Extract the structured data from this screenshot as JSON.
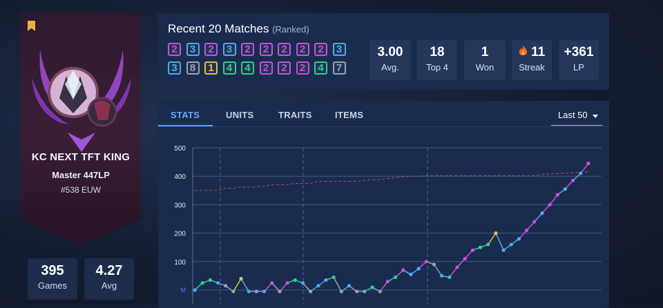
{
  "profile": {
    "summoner_name": "KC NEXT TFT KING",
    "rank": "Master 447LP",
    "ladder": "#538 EUW",
    "games_value": "395",
    "games_label": "Games",
    "avg_value": "4.27",
    "avg_label": "Avg"
  },
  "recent": {
    "title": "Recent 20 Matches",
    "subtitle": "(Ranked)",
    "placements": [
      2,
      3,
      2,
      3,
      2,
      2,
      2,
      2,
      2,
      3,
      3,
      8,
      1,
      4,
      4,
      2,
      2,
      2,
      4,
      7
    ],
    "placement_colors": {
      "1": "#e5c04a",
      "2": "#c850d8",
      "3": "#4fa8ec",
      "4": "#2fcf8e",
      "7": "#9aa2b2",
      "8": "#9aa2b2"
    },
    "stats": [
      {
        "value": "3.00",
        "label": "Avg."
      },
      {
        "value": "18",
        "label": "Top 4"
      },
      {
        "value": "1",
        "label": "Won"
      },
      {
        "value": "11",
        "label": "Streak"
      },
      {
        "value": "+361",
        "label": "LP"
      }
    ]
  },
  "tabs": [
    "STATS",
    "UNITS",
    "TRAITS",
    "ITEMS"
  ],
  "active_tab": "STATS",
  "range_select": "Last 50",
  "chart_data": {
    "type": "line",
    "y_ticks": [
      "500",
      "400",
      "300",
      "200",
      "100"
    ],
    "ylim": [
      0,
      500
    ],
    "baseline_label": "M",
    "series": [
      {
        "values": [
          0,
          25,
          35,
          25,
          15,
          -5,
          40,
          -5,
          -5,
          -5,
          25,
          -5,
          25,
          35,
          25,
          -5,
          15,
          35,
          45,
          -5,
          15,
          -5,
          -5,
          10,
          -5,
          30,
          45,
          70,
          55,
          75,
          100,
          90,
          50,
          45,
          80,
          110,
          140,
          150,
          160,
          200,
          140,
          160,
          180,
          210,
          240,
          270,
          300,
          335,
          355,
          385,
          410,
          445
        ],
        "point_placements": [
          3,
          4,
          4,
          3,
          7,
          7,
          1,
          3,
          7,
          3,
          2,
          7,
          2,
          4,
          3,
          7,
          3,
          3,
          4,
          7,
          3,
          7,
          7,
          4,
          7,
          2,
          4,
          2,
          3,
          3,
          2,
          7,
          3,
          4,
          2,
          2,
          2,
          4,
          4,
          1,
          3,
          3,
          3,
          2,
          2,
          3,
          2,
          2,
          3,
          2,
          3,
          2
        ]
      },
      {
        "style": "dashed",
        "color": "#b04a6a",
        "values": [
          350,
          350,
          350,
          350,
          358,
          358,
          362,
          362,
          362,
          365,
          370,
          370,
          370,
          375,
          375,
          375,
          382,
          382,
          382,
          382,
          382,
          382,
          385,
          388,
          388,
          392,
          395,
          398,
          400,
          400,
          402,
          402,
          402,
          402,
          402,
          402,
          402,
          402,
          402,
          402,
          402,
          402,
          402,
          402,
          402,
          405,
          408,
          410,
          410,
          412,
          415,
          415
        ]
      }
    ]
  }
}
